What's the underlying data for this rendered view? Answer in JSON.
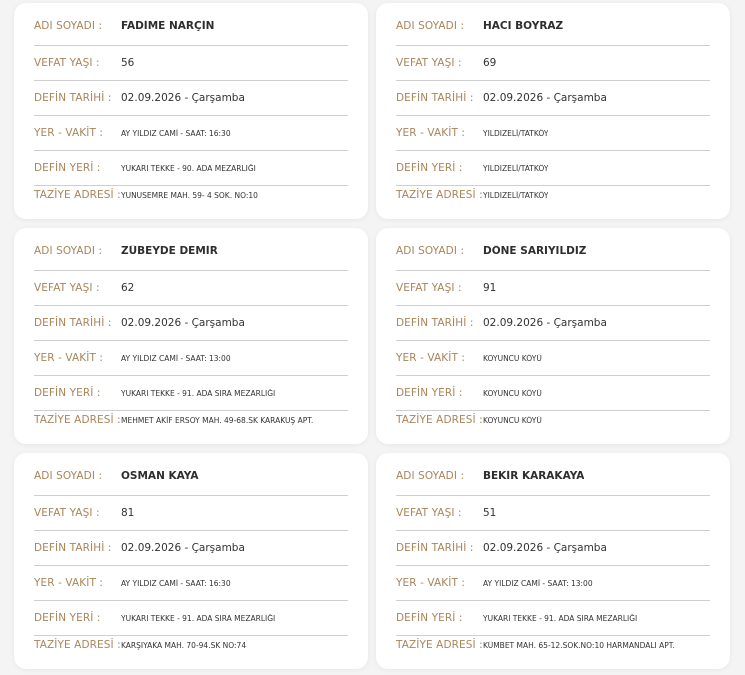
{
  "labels": {
    "name": "ADI SOYADI :",
    "age": "VEFAT YAŞI :",
    "date": "DEFİN TARİHİ :",
    "place_time": "YER - VAKİT :",
    "burial": "DEFİN YERİ :",
    "condolence": "TAZİYE ADRESİ :"
  },
  "records": [
    {
      "name": "FADİME NARÇİN",
      "age": "56",
      "date": "02.09.2026 - Çarşamba",
      "place_time": "AY YILDIZ CAMİ - SAAT: 16:30",
      "burial": "YUKARI TEKKE - 90. ADA MEZARLIĞI",
      "condolence": "YUNUSEMRE MAH. 59- 4 SOK. NO:10"
    },
    {
      "name": "HACI BOYRAZ",
      "age": "69",
      "date": "02.09.2026 - Çarşamba",
      "place_time": "YILDIZELİ/TATKÖY",
      "burial": "YILDIZELİ/TATKÖY",
      "condolence": "YILDIZELİ/TATKÖY"
    },
    {
      "name": "ZÜBEYDE DEMİR",
      "age": "62",
      "date": "02.09.2026 - Çarşamba",
      "place_time": "AY YILDIZ CAMİ - SAAT: 13:00",
      "burial": "YUKARI TEKKE - 91. ADA SIRA MEZARLIĞI",
      "condolence": "MEHMET AKİF ERSOY MAH. 49-68.SK KARAKUŞ APT."
    },
    {
      "name": "DÖNE SARIYILDIZ",
      "age": "91",
      "date": "02.09.2026 - Çarşamba",
      "place_time": "KOYUNCU KÖYÜ",
      "burial": "KOYUNCU KÖYÜ",
      "condolence": "KOYUNCU KÖYÜ"
    },
    {
      "name": "OSMAN KAYA",
      "age": "81",
      "date": "02.09.2026 - Çarşamba",
      "place_time": "AY YILDIZ CAMİ - SAAT: 16:30",
      "burial": "YUKARI TEKKE - 91. ADA SIRA MEZARLIĞI",
      "condolence": "KARŞIYAKA MAH. 70-94.SK NO:74"
    },
    {
      "name": "BEKİR KARAKAYA",
      "age": "51",
      "date": "02.09.2026 - Çarşamba",
      "place_time": "AY YILDIZ CAMİ - SAAT: 13:00",
      "burial": "YUKARI TEKKE - 91. ADA SIRA MEZARLIĞI",
      "condolence": "KÜMBET MAH. 65-12.SOK.NO:10 HARMANDALI APT."
    }
  ]
}
